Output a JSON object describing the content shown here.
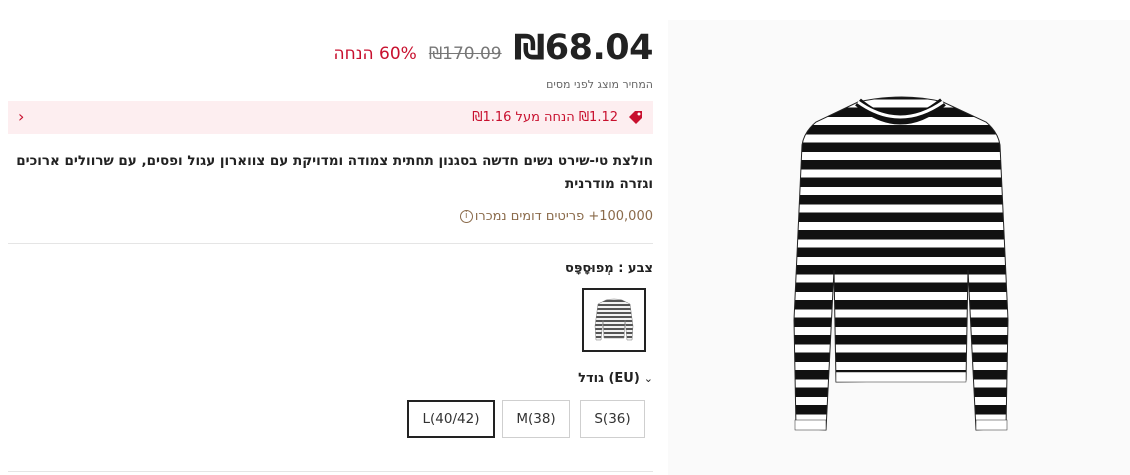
{
  "product": {
    "price": "₪68.04",
    "original_price": "₪170.09",
    "discount": "60% הנחה",
    "tax_note": "המחיר מוצג לפני מסים",
    "title": "חולצת טי-שירט נשים חדשה בסגנון תחתית צמודה ומדויקת עם צווארון עגול ופסים, עם שרוולים ארוכים וגזרה מודרנית",
    "sold_text": "100,000+ פריטים דומים נמכרו"
  },
  "promo": {
    "text": "₪1.12 הנחה מעל ₪1.16",
    "arrow": "›",
    "accent": "#c8102e",
    "background": "#fdeef0"
  },
  "color": {
    "label": "צבע : מְפוּסָפָּס"
  },
  "size": {
    "label": "גודל (EU)",
    "options": [
      "S(36)",
      "M(38)",
      "L(40/42)"
    ],
    "selected": "L(40/42)"
  },
  "icons": {
    "tag": "price-tag-icon",
    "info": "info-icon",
    "chevron": "chevron-down-icon",
    "arrow": "chevron-left-icon"
  }
}
